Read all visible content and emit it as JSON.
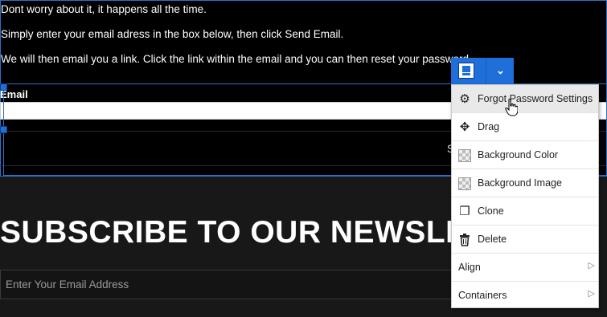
{
  "forgot_password": {
    "line1": "Dont worry about it, it happens all the time.",
    "line2": "Simply enter your email adress in the box below, then click Send Email.",
    "line3": "We will then email you a link. Click the link within the email and you can then reset your password.",
    "email_label": "Email",
    "email_value": "",
    "send_label": "S"
  },
  "newsletter": {
    "title": "SUBSCRIBE TO OUR NEWSLE",
    "input_placeholder": "Enter Your Email Address"
  },
  "toolbar": {
    "element_icon": "form-element-icon",
    "dropdown_icon": "chevron-down-icon",
    "dropdown_glyph": "⌄"
  },
  "context_menu": {
    "items": [
      {
        "label": "Forgot Password Settings",
        "icon": "gear-icon",
        "glyph": "⚙"
      },
      {
        "label": "Drag",
        "icon": "move-icon",
        "glyph": "✥"
      },
      {
        "label": "Background Color",
        "icon": "checker-icon"
      },
      {
        "label": "Background Image",
        "icon": "checker-icon"
      },
      {
        "label": "Clone",
        "icon": "clone-icon",
        "glyph": "❐"
      },
      {
        "label": "Delete",
        "icon": "trash-icon",
        "glyph": "🗑"
      },
      {
        "label": "Align",
        "icon": "",
        "submenu": true
      },
      {
        "label": "Containers",
        "icon": "",
        "submenu": true
      }
    ],
    "submenu_glyph": "▷"
  },
  "colors": {
    "accent": "#1e6fd9",
    "page_bg": "#181818",
    "block_bg": "#000000",
    "menu_hover": "#e9e9e9"
  }
}
